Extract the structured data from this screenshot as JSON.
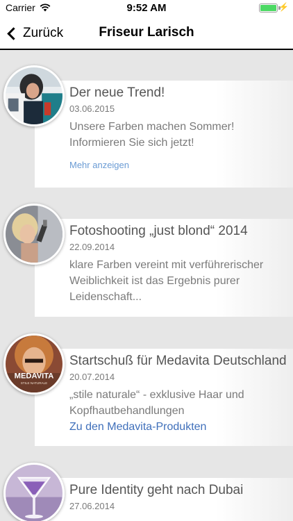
{
  "status_bar": {
    "carrier": "Carrier",
    "time": "9:52 AM",
    "battery_level_pct": 100
  },
  "nav": {
    "back_label": "Zurück",
    "title": "Friseur Larisch"
  },
  "news": [
    {
      "title": "Der neue Trend!",
      "date": "03.06.2015",
      "text": "Unsere Farben machen Sommer! Informieren Sie sich jetzt!",
      "more_label": "Mehr anzeigen"
    },
    {
      "title": "Fotoshooting „just blond“ 2014",
      "date": "22.09.2014",
      "text": "klare Farben vereint mit verführerischer Weiblichkeit ist das Ergebnis purer Leidenschaft..."
    },
    {
      "title": "Startschuß für Medavita Deutschland",
      "date": "20.07.2014",
      "text": "„stile naturale“ - exklusive Haar und Kopfhautbehandlungen",
      "link_label": "Zu den Medavita-Produkten",
      "thumb_brand": "MEDAVITA",
      "thumb_tagline": "STILE NATURALE"
    },
    {
      "title": "Pure Identity geht nach Dubai",
      "date": "27.06.2014",
      "text": ""
    }
  ],
  "colors": {
    "link": "#3f6fba",
    "more_link": "#6a9bd4",
    "title_text": "#555555",
    "body_text": "#7a7a7a",
    "battery": "#4cd964"
  }
}
